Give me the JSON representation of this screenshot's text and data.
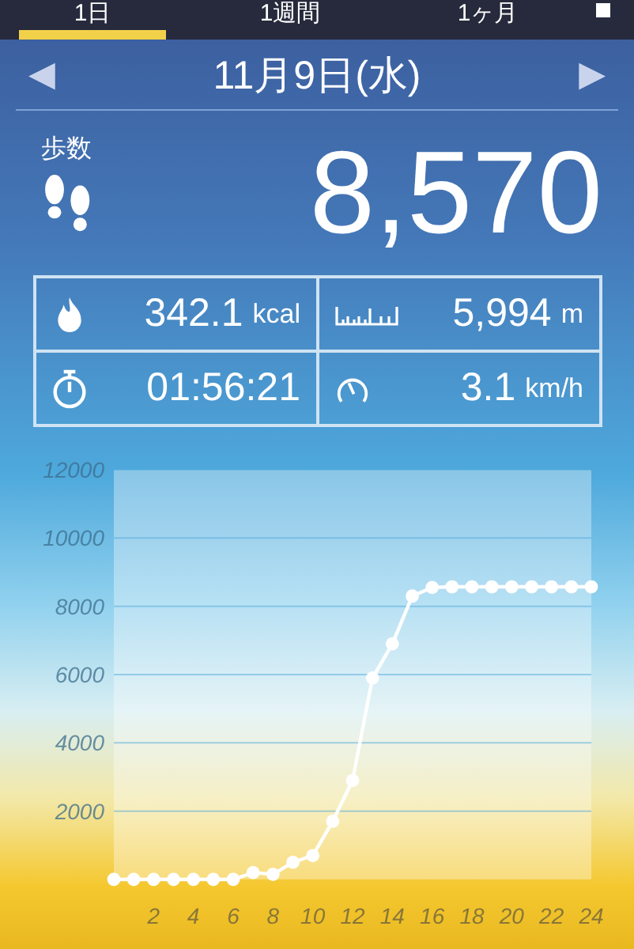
{
  "tabs": [
    {
      "label": "1日",
      "selected": true
    },
    {
      "label": "1週間",
      "selected": false
    },
    {
      "label": "1ヶ月",
      "selected": false
    }
  ],
  "date": {
    "prev": "◀",
    "label": "11月9日(水)",
    "next": "▶"
  },
  "steps": {
    "label": "歩数",
    "value": "8,570"
  },
  "stats": [
    {
      "kind": "calories",
      "value": "342.1",
      "unit": "kcal"
    },
    {
      "kind": "distance",
      "value": "5,994",
      "unit": "m"
    },
    {
      "kind": "time",
      "value": "01:56:21"
    },
    {
      "kind": "speed",
      "value": "3.1",
      "unit": "km/h"
    }
  ],
  "chart_data": {
    "type": "line",
    "x": [
      0,
      1,
      2,
      3,
      4,
      5,
      6,
      7,
      8,
      9,
      10,
      11,
      12,
      13,
      14,
      15,
      16,
      17,
      18,
      19,
      20,
      21,
      22,
      23,
      24
    ],
    "grid": true,
    "series": [
      {
        "color": "#ffffff",
        "marker": true,
        "values": [
          0,
          0,
          0,
          0,
          0,
          0,
          0,
          200,
          150,
          500,
          700,
          1700,
          2900,
          5900,
          6900,
          8300,
          8550,
          8570,
          8570,
          8570,
          8570,
          8570,
          8570,
          8570,
          8570
        ]
      }
    ],
    "xlim": [
      0,
      24
    ],
    "ylim": [
      0,
      12000
    ],
    "xticks": [
      2,
      4,
      6,
      8,
      10,
      12,
      14,
      16,
      18,
      20,
      22,
      24
    ],
    "yticks": [
      2000,
      4000,
      6000,
      8000,
      10000,
      12000
    ]
  }
}
